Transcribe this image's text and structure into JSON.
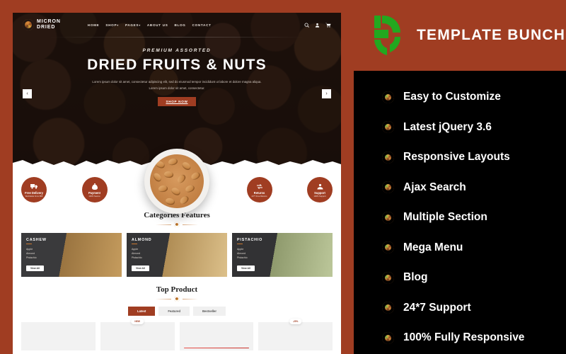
{
  "promo": {
    "brand_name": "TEMPLATE BUNCH",
    "brand_color": "#a03d22",
    "logo_color": "#22a81f",
    "logo_icon": "template-bunch-logo",
    "features": [
      {
        "icon": "nut-ring-icon",
        "label": "Easy to Customize"
      },
      {
        "icon": "nut-ring-icon",
        "label": "Latest jQuery 3.6"
      },
      {
        "icon": "nut-ring-icon",
        "label": "Responsive Layouts"
      },
      {
        "icon": "nut-ring-icon",
        "label": "Ajax Search"
      },
      {
        "icon": "nut-ring-icon",
        "label": "Multiple Section"
      },
      {
        "icon": "nut-ring-icon",
        "label": "Mega Menu"
      },
      {
        "icon": "nut-ring-icon",
        "label": "Blog"
      },
      {
        "icon": "nut-ring-icon",
        "label": "24*7 Support"
      },
      {
        "icon": "nut-ring-icon",
        "label": "100% Fully Responsive"
      }
    ]
  },
  "site": {
    "logo": {
      "line1": "MICRON",
      "line2": "DRIED"
    },
    "nav": [
      {
        "label": "HOME",
        "caret": ""
      },
      {
        "label": "SHOP",
        "caret": "▾"
      },
      {
        "label": "PAGES",
        "caret": "▾"
      },
      {
        "label": "ABOUT US",
        "caret": ""
      },
      {
        "label": "BLOG",
        "caret": ""
      },
      {
        "label": "CONTACT",
        "caret": ""
      }
    ],
    "nav_icons": [
      "search-icon",
      "user-icon",
      "cart-icon"
    ],
    "hero": {
      "eyebrow": "PREMIUM ASSORTED",
      "title": "DRIED FRUITS & NUTS",
      "subtitle": "Lorem ipsum dolor sit amet, consectetur adipiscing elit, sed do eiusmod tempor incididunt ut labore et dolore magna aliqua. Lorem ipsum dolor sit amet, consectetur.",
      "cta": "SHOP NOW",
      "prev_arrow": "‹",
      "next_arrow": "›"
    },
    "badges": [
      {
        "icon": "truck-icon",
        "title": "Free Delivery",
        "sub": "Worldwide From $55"
      },
      {
        "icon": "money-bag-icon",
        "title": "Payment",
        "sub": "100% Secure"
      },
      {
        "icon": "return-arrows-icon",
        "title": "Returns",
        "sub": "24*7 Free Returns"
      },
      {
        "icon": "headset-support-icon",
        "title": "Support",
        "sub": "100% Support"
      }
    ],
    "categories_section": {
      "title": "Categories Features",
      "cards": [
        {
          "name": "CASHEW",
          "items": [
            "Apple",
            "Almond",
            "Pistachio"
          ],
          "button": "View All"
        },
        {
          "name": "ALMOND",
          "items": [
            "Apple",
            "Almond",
            "Pistachio"
          ],
          "button": "View All"
        },
        {
          "name": "PISTACHIO",
          "items": [
            "Apple",
            "Almond",
            "Pistachio"
          ],
          "button": "View All"
        }
      ]
    },
    "top_product": {
      "title": "Top Product",
      "tabs": [
        {
          "label": "Latest",
          "active": true
        },
        {
          "label": "Featured",
          "active": false
        },
        {
          "label": "Bestseller",
          "active": false
        }
      ],
      "products": [
        {
          "badge": ""
        },
        {
          "badge": "NEW"
        },
        {
          "badge": ""
        },
        {
          "badge": "-20%"
        }
      ]
    }
  }
}
